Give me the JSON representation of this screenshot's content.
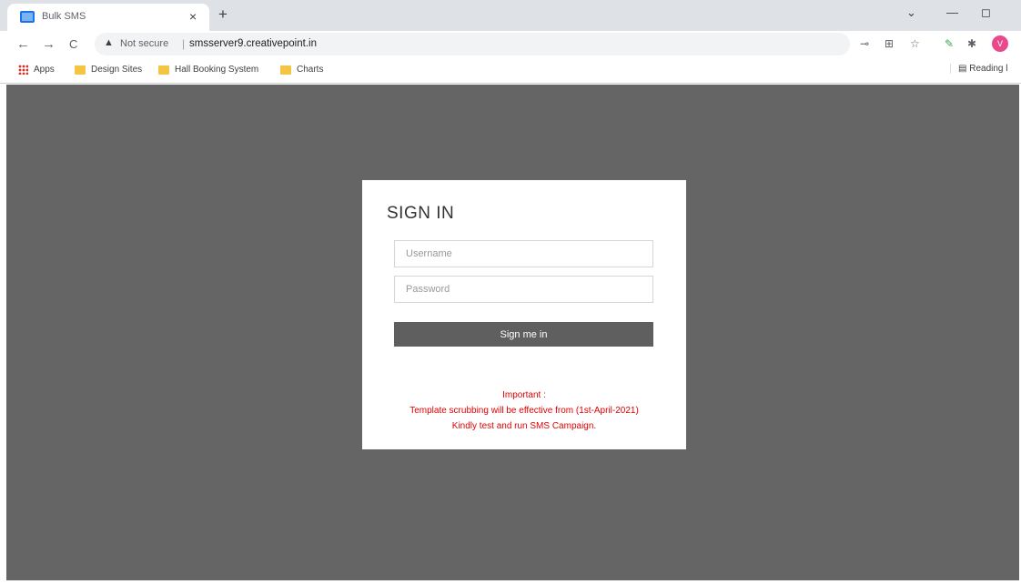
{
  "browser": {
    "tab_title": "Bulk SMS",
    "tab_close": "×",
    "new_tab": "+",
    "window_controls": [
      "⌄",
      "—",
      "◻"
    ],
    "nav": {
      "back": "←",
      "forward": "→",
      "reload": "C"
    },
    "address": {
      "security_label": "Not secure",
      "separator": "|",
      "url": "smsserver9.creativepoint.in"
    },
    "avatar_initial": "V",
    "bookmarks": [
      "Apps",
      "Design Sites",
      "Hall Booking System",
      "Charts"
    ],
    "reading_list": "Reading l"
  },
  "signin": {
    "title": "SIGN IN",
    "username_placeholder": "Username",
    "password_placeholder": "Password",
    "button_label": "Sign me in",
    "notice": {
      "line1": "Important :",
      "line2": "Template scrubbing will be effective from (1st-April-2021)",
      "line3": "Kindly test and run SMS Campaign."
    }
  },
  "colors": {
    "page_background": "#656565",
    "button": "#5f5f5f",
    "notice_text": "#e00000"
  }
}
